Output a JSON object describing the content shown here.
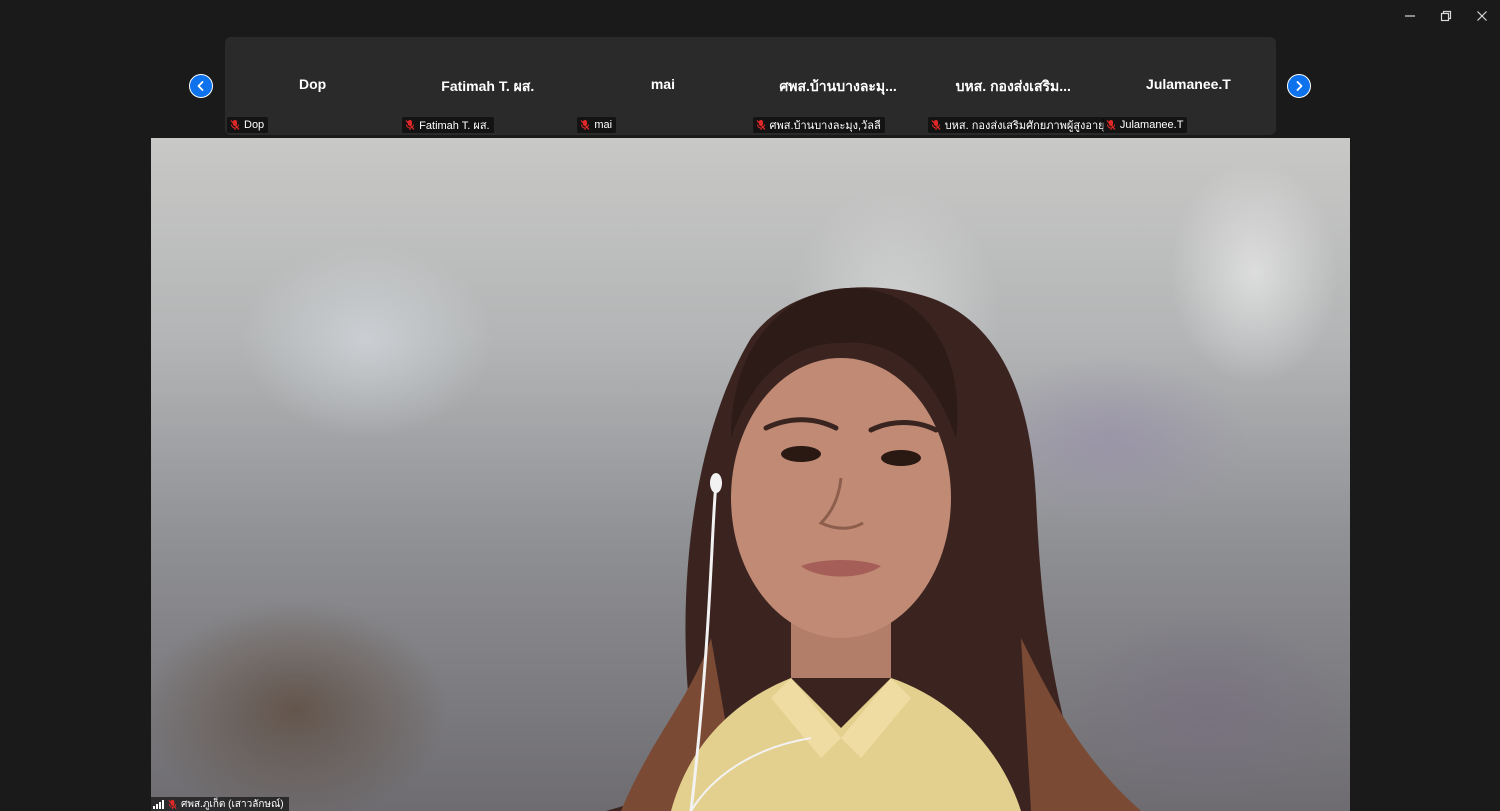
{
  "window_controls": {
    "minimize": "minimize-icon",
    "restore": "restore-icon",
    "close": "close-icon"
  },
  "strip": {
    "prev_icon": "chevron-left-icon",
    "next_icon": "chevron-right-icon",
    "tiles": [
      {
        "name": "Dop",
        "label": "Dop",
        "muted": true
      },
      {
        "name": "Fatimah T. ผส.",
        "label": "Fatimah T. ผส.",
        "muted": true
      },
      {
        "name": "mai",
        "label": "mai",
        "muted": true
      },
      {
        "name": "ศพส.บ้านบางละมุ...",
        "label": "ศพส.บ้านบางละมุง,วัลลี",
        "muted": true
      },
      {
        "name": "บหส. กองส่งเสริม...",
        "label": "บหส. กองส่งเสริมศักยภาพผู้สูงอายุ",
        "muted": true
      },
      {
        "name": "Julamanee.T",
        "label": "Julamanee.T",
        "muted": true
      }
    ]
  },
  "main": {
    "speaker_label": "ศพส.ภูเก็ต (เสาวลักษณ์)",
    "muted": true,
    "icons": [
      "signal-icon",
      "mic-off-icon"
    ]
  },
  "colors": {
    "background": "#1a1a1a",
    "strip_bg": "#2a2a2a",
    "nav_button": "#0e72ed",
    "muted_icon": "#e02828"
  }
}
